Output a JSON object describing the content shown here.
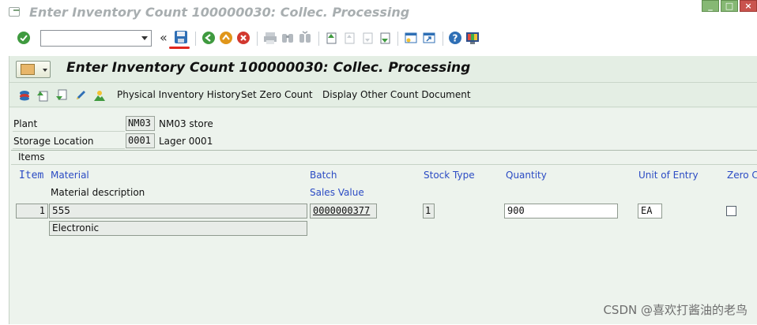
{
  "window": {
    "title": "Enter Inventory Count 100000030: Collec. Processing",
    "controls": {
      "minimize": "_",
      "maximize": "□",
      "close": "×"
    }
  },
  "system_toolbar": {
    "command_field_value": "",
    "collapse_glyph": "«",
    "icons": [
      "enter-icon",
      "save-icon",
      "back-icon",
      "exit-icon",
      "cancel-icon",
      "print-icon",
      "find-icon",
      "find-next-icon",
      "first-page-icon",
      "previous-page-icon",
      "next-page-icon",
      "last-page-icon",
      "create-session-icon",
      "shortcut-icon",
      "help-icon",
      "customize-layout-icon"
    ],
    "accent_colors": {
      "enter": "#3f9a3f",
      "back": "#3f9a3f",
      "exit": "#e0961a",
      "cancel": "#d2382f",
      "save": "#2f6fb5",
      "help": "#2f6fb5"
    }
  },
  "app": {
    "title": "Enter Inventory Count 100000030: Collec. Processing",
    "toolbar": {
      "buttons": [
        "Physical Inventory History",
        "Set Zero Count",
        "Display Other Count Document"
      ]
    }
  },
  "header": {
    "plant_label": "Plant",
    "plant_code": "NM03",
    "plant_name": "NM03 store",
    "storage_location_label": "Storage Location",
    "storage_location_code": "0001",
    "storage_location_name": "Lager 0001"
  },
  "items": {
    "group_title": "Items",
    "columns": {
      "item": "Item",
      "material": "Material",
      "batch": "Batch",
      "stock_type": "Stock Type",
      "quantity": "Quantity",
      "unit_of_entry": "Unit of Entry",
      "zero_count": "Zero Co"
    },
    "sub_columns": {
      "material_description": "Material description",
      "sales_value": "Sales Value"
    },
    "rows": [
      {
        "item": "1",
        "material": "555",
        "material_description": "Electronic",
        "sales_value": "0000000377",
        "stock_type": "1",
        "quantity": "900",
        "unit_of_entry": "EA",
        "zero_count": false
      }
    ]
  },
  "watermark": "CSDN @喜欢打酱油的老鸟"
}
